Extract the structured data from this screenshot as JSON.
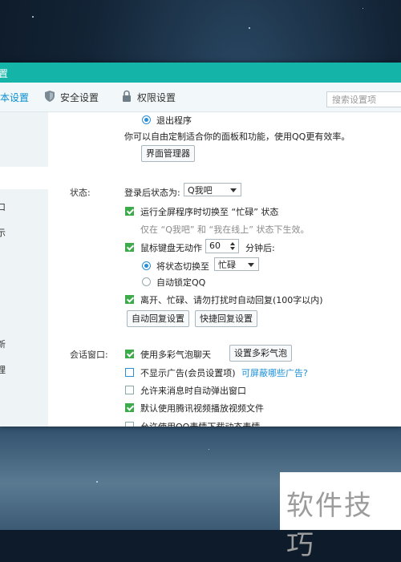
{
  "window": {
    "title_fragment": "置"
  },
  "tabs": [
    {
      "label": "本设置",
      "icon": "none"
    },
    {
      "label": "安全设置",
      "icon": "shield-icon"
    },
    {
      "label": "权限设置",
      "icon": "lock-icon"
    }
  ],
  "search": {
    "placeholder": "搜索设置项"
  },
  "sidebar": {
    "fragments": [
      "口",
      "示",
      "新",
      "理"
    ]
  },
  "panel": {
    "quit_label": "退出程序",
    "customize_text": "你可以自由定制适合你的面板和功能，使用QQ更有效率。",
    "interface_manager_button": "界面管理器",
    "status_section": "状态:",
    "login_status_label": "登录后状态为:",
    "login_status_value": "Q我吧",
    "fullscreen_busy_label": "运行全屏程序时切换至 “忙碌” 状态",
    "fullscreen_busy_hint": "仅在 “Q我吧” 和 “我在线上” 状态下生效。",
    "idle_label": "鼠标键盘无动作",
    "idle_minutes": "60",
    "idle_after": "分钟后:",
    "switch_status_label": "将状态切换至",
    "switch_status_value": "忙碌",
    "auto_lock_label": "自动锁定QQ",
    "auto_reply_label": "离开、忙碌、请勿打扰时自动回复(100字以内)",
    "auto_reply_button": "自动回复设置",
    "quick_reply_button": "快捷回复设置",
    "chat_section": "会话窗口:",
    "bubble_label": "使用多彩气泡聊天",
    "bubble_button": "设置多彩气泡",
    "no_ads_label": "不显示广告(会员设置项)",
    "no_ads_link": "可屏蔽哪些广告?",
    "popup_label": "允许来消息时自动弹出窗口",
    "video_label": "默认使用腾讯视频播放视频文件",
    "partial_label": "允许使用QQ表情下载动态表情"
  },
  "watermark": "软件技巧",
  "colors": {
    "titlebar": "#14b4a8",
    "accent": "#0a8fd0",
    "check": "#3cab4a"
  }
}
